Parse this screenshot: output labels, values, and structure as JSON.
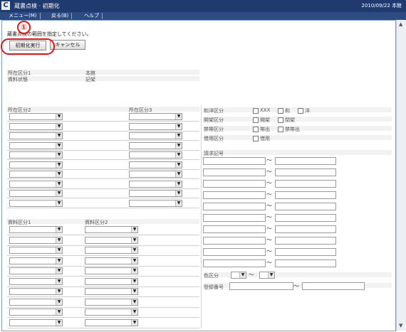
{
  "window": {
    "title": "蔵書点検 · 初期化",
    "date": "2010/09/22 本館",
    "logo": "C"
  },
  "menu": [
    "メニュー(M)",
    "戻る(B)",
    "ヘルプ"
  ],
  "instruction": "蔵書点検の範囲を指定してください。",
  "buttons": {
    "run": "初期化実行",
    "cancel": "キャンセル"
  },
  "callout": {
    "number": "①"
  },
  "info": [
    {
      "label": "所在区分1",
      "value": "本館"
    },
    {
      "label": "資料状態",
      "value": "記架"
    }
  ],
  "sections": {
    "shozai2": "所在区分2",
    "shozai3": "所在区分3",
    "shiryo1": "資料区分1",
    "shiryo2": "資料区分2",
    "seikyu": "請求記号",
    "iro": "色区分",
    "toroku": "登録番号"
  },
  "wayou": {
    "label": "和洋区分",
    "options": [
      "XXX",
      "和",
      "洋"
    ]
  },
  "kaika": {
    "label": "開架区分",
    "options": [
      "開架",
      "閉架"
    ]
  },
  "kinobu": {
    "label": "禁帯区分",
    "options": [
      "帯出",
      "禁帯出"
    ]
  },
  "shiyou": {
    "label": "借用区分",
    "options": [
      "借用"
    ]
  },
  "tilde": "～",
  "dropdown_arrow": "▼",
  "colors": {
    "title_bar": "#1f3a6e",
    "menu_bar": "#2c4b82",
    "callout": "#e11111"
  }
}
